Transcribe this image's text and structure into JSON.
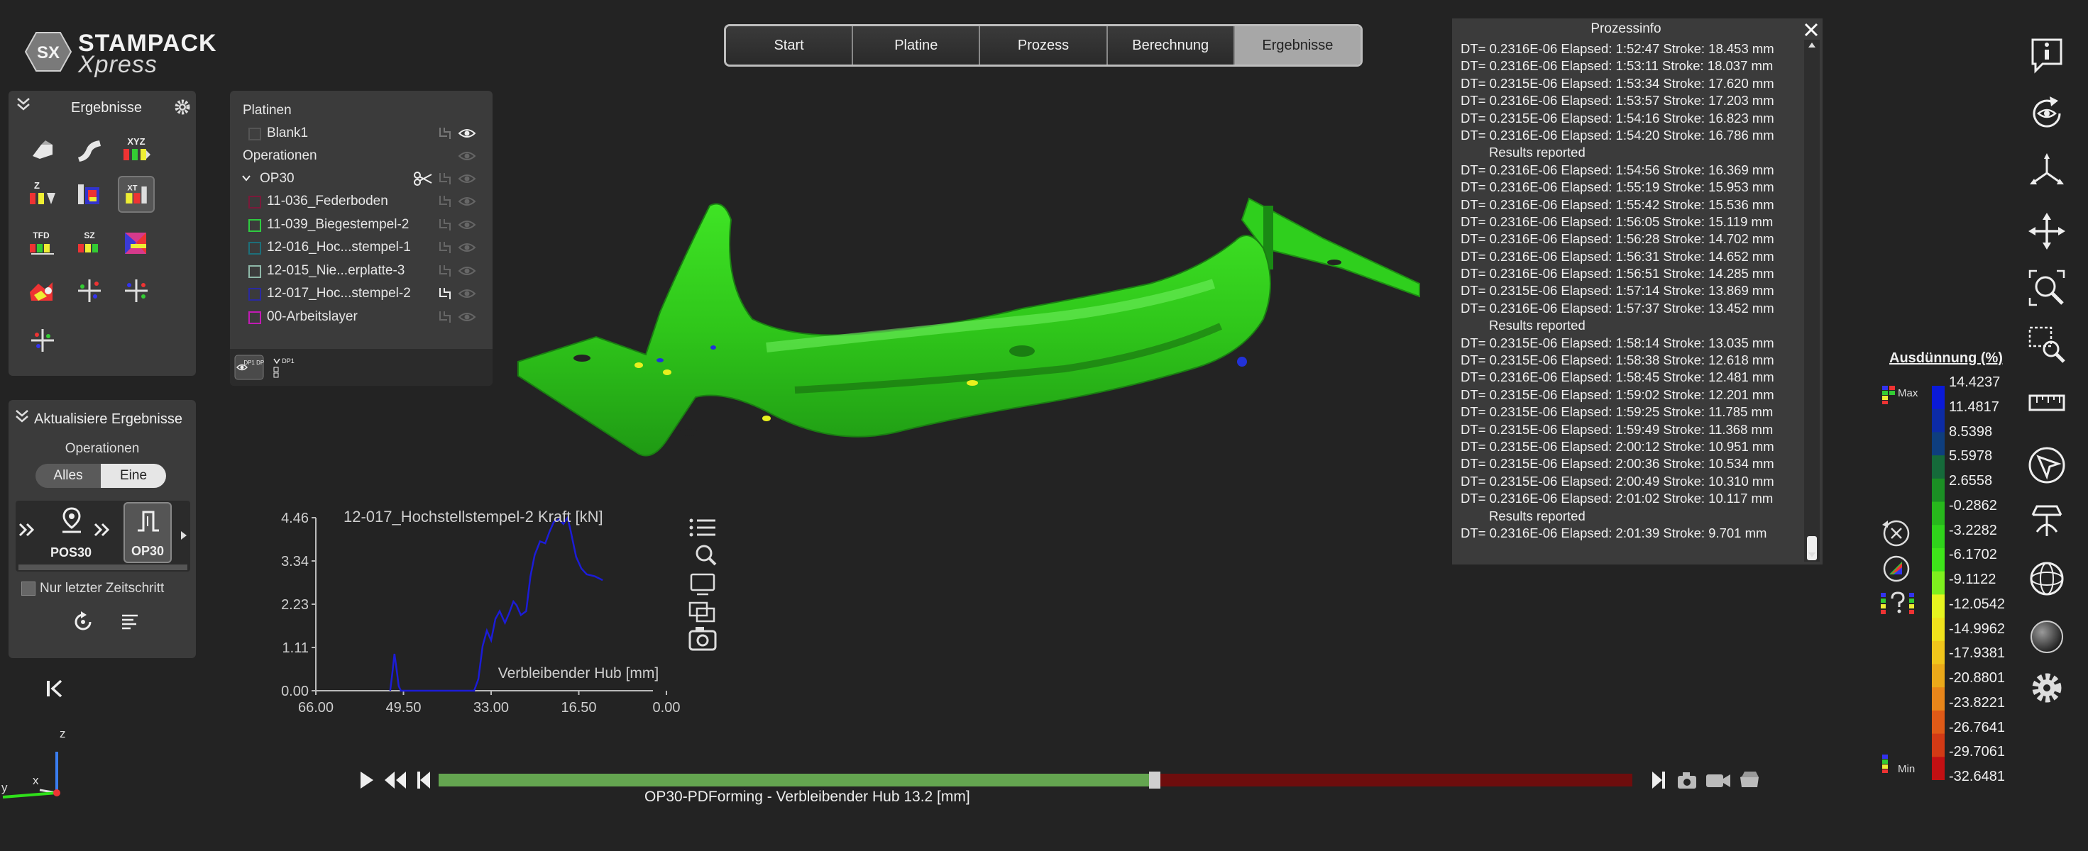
{
  "logo": {
    "badge": "SX",
    "line1": "STAMPACK",
    "line2": "Xpress"
  },
  "tabs": [
    {
      "label": "Start",
      "active": false
    },
    {
      "label": "Platine",
      "active": false
    },
    {
      "label": "Prozess",
      "active": false
    },
    {
      "label": "Berechnung",
      "active": false
    },
    {
      "label": "Ergebnisse",
      "active": true
    }
  ],
  "results_panel": {
    "title": "Ergebnisse",
    "icons": [
      "thinning-icon",
      "shape-icon",
      "xyz-displacement-icon",
      "z-displacement-icon",
      "formability-icon",
      "t-thickness-icon",
      "tfd-icon",
      "sz-icon",
      "strain-icon",
      "wrinkle-icon",
      "springback-icon",
      "vector-icon",
      "trim-icon"
    ],
    "icon_labels": {
      "xyz": "XYZ",
      "z": "Z",
      "xt": "XT",
      "tfd": "TFD",
      "sz": "SZ"
    }
  },
  "update_panel": {
    "title": "Aktualisiere Ergebnisse",
    "sub": "Operationen",
    "seg_all": "Alles",
    "seg_one": "Eine",
    "ops": [
      {
        "label": "POS30"
      },
      {
        "label": "OP30"
      }
    ],
    "checkbox": "Nur letzter Zeitschritt"
  },
  "tree": {
    "section_blanks": "Platinen",
    "blank": "Blank1",
    "section_ops": "Operationen",
    "op": "OP30",
    "tools": [
      {
        "name": "11-036_Federboden",
        "color": "#7a1a3a"
      },
      {
        "name": "11-039_Biegestempel-2",
        "color": "#2ecc40"
      },
      {
        "name": "12-016_Hoc...stempel-1",
        "color": "#1d6f7a"
      },
      {
        "name": "12-015_Nie...erplatte-3",
        "color": "#8fb8a8"
      },
      {
        "name": "12-017_Hoc...stempel-2",
        "color": "#2a2aa0"
      },
      {
        "name": "00-Arbeitslayer",
        "color": "#c21ab4"
      }
    ],
    "foot_a": "DP1 DP2",
    "foot_b": "DP1"
  },
  "chart_data": {
    "type": "line",
    "title": "12-017_Hochstellstempel-2 Kraft [kN]",
    "xlabel": "Verbleibender Hub [mm]",
    "ylabel": "",
    "x_ticks": [
      "66.00",
      "49.50",
      "33.00",
      "16.50",
      "0.00"
    ],
    "y_ticks": [
      "4.46",
      "3.34",
      "2.23",
      "1.11",
      "0.00"
    ],
    "xlim": [
      66.0,
      0.0
    ],
    "ylim": [
      0.0,
      4.46
    ],
    "series": [
      {
        "color": "#1c1cd6",
        "x": [
          52.0,
          51.6,
          51.2,
          50.8,
          50.4,
          50.0,
          49.6,
          49.0,
          45.0,
          40.0,
          36.2,
          35.4,
          34.6,
          33.8,
          33.0,
          32.2,
          31.4,
          30.4,
          29.6,
          28.8,
          28.2,
          27.4,
          26.4,
          25.6,
          24.8,
          23.8,
          22.8,
          22.0,
          21.2,
          20.2,
          19.4,
          18.6,
          18.0,
          17.0,
          16.0,
          15.0,
          13.5,
          12.0
        ],
        "y": [
          0.0,
          0.45,
          0.95,
          0.55,
          0.12,
          0.0,
          0.0,
          0.0,
          0.0,
          0.0,
          0.0,
          0.3,
          1.15,
          1.55,
          1.3,
          1.85,
          2.05,
          1.75,
          2.0,
          2.3,
          2.2,
          1.95,
          2.05,
          2.95,
          3.5,
          3.85,
          3.8,
          4.1,
          4.35,
          4.42,
          4.3,
          4.46,
          4.1,
          3.45,
          3.15,
          3.0,
          2.95,
          2.85
        ]
      }
    ]
  },
  "process_info": {
    "title": "Prozessinfo",
    "lines": [
      "DT= 0.2316E-06  Elapsed: 1:52:47  Stroke: 18.453 mm",
      "DT= 0.2316E-06  Elapsed: 1:53:11  Stroke: 18.037 mm",
      "DT= 0.2315E-06  Elapsed: 1:53:34  Stroke: 17.620 mm",
      "DT= 0.2316E-06  Elapsed: 1:53:57  Stroke: 17.203 mm",
      "DT= 0.2315E-06  Elapsed: 1:54:16  Stroke: 16.823 mm",
      "DT= 0.2316E-06  Elapsed: 1:54:20  Stroke: 16.786 mm",
      "Results reported",
      "DT= 0.2316E-06  Elapsed: 1:54:56  Stroke: 16.369 mm",
      "DT= 0.2316E-06  Elapsed: 1:55:19  Stroke: 15.953 mm",
      "DT= 0.2316E-06  Elapsed: 1:55:42  Stroke: 15.536 mm",
      "DT= 0.2316E-06  Elapsed: 1:56:05  Stroke: 15.119 mm",
      "DT= 0.2316E-06  Elapsed: 1:56:28  Stroke: 14.702 mm",
      "DT= 0.2316E-06  Elapsed: 1:56:31  Stroke: 14.652 mm",
      "DT= 0.2316E-06  Elapsed: 1:56:51  Stroke: 14.285 mm",
      "DT= 0.2315E-06  Elapsed: 1:57:14  Stroke: 13.869 mm",
      "DT= 0.2316E-06  Elapsed: 1:57:37  Stroke: 13.452 mm",
      "Results reported",
      "DT= 0.2315E-06  Elapsed: 1:58:14  Stroke: 13.035 mm",
      "DT= 0.2315E-06  Elapsed: 1:58:38  Stroke: 12.618 mm",
      "DT= 0.2316E-06  Elapsed: 1:58:45  Stroke: 12.481 mm",
      "DT= 0.2315E-06  Elapsed: 1:59:02  Stroke: 12.201 mm",
      "DT= 0.2315E-06  Elapsed: 1:59:25  Stroke: 11.785 mm",
      "DT= 0.2315E-06  Elapsed: 1:59:49  Stroke: 11.368 mm",
      "DT= 0.2315E-06  Elapsed: 2:00:12  Stroke: 10.951 mm",
      "DT= 0.2315E-06  Elapsed: 2:00:36  Stroke: 10.534 mm",
      "DT= 0.2315E-06  Elapsed: 2:00:49  Stroke: 10.310 mm",
      "DT= 0.2316E-06  Elapsed: 2:01:02  Stroke: 10.117 mm",
      "Results reported",
      "DT= 0.2316E-06  Elapsed: 2:01:39  Stroke: 9.701 mm"
    ]
  },
  "legend": {
    "title": "Ausdünnung (%)",
    "max_label": "Max",
    "min_label": "Min",
    "values": [
      "14.4237",
      "11.4817",
      "8.5398",
      "5.5978",
      "2.6558",
      "-0.2862",
      "-3.2282",
      "-6.1702",
      "-9.1122",
      "-12.0542",
      "-14.9962",
      "-17.9381",
      "-20.8801",
      "-23.8221",
      "-26.7641",
      "-29.7061",
      "-32.6481"
    ],
    "colors": [
      "#0a1ad8",
      "#0c2ba6",
      "#0e3e7e",
      "#156a3a",
      "#1b8f24",
      "#27b81c",
      "#2fd31b",
      "#3ee51a",
      "#7ef01e",
      "#e6f41f",
      "#f0e21c",
      "#f0c51b",
      "#eba919",
      "#e8861a",
      "#df5a17",
      "#d23a15",
      "#c21013"
    ]
  },
  "right_toolbar": [
    "info-icon",
    "rotate-view-icon",
    "axes-icon",
    "pan-icon",
    "zoom-icon",
    "zoom-window-icon",
    "ruler-icon",
    "select-pointer-icon",
    "tool-probe-icon",
    "sphere-wire-icon",
    "sphere-solid-icon",
    "settings-gear-icon"
  ],
  "triad": {
    "z": "z",
    "x": "x",
    "y": "y"
  },
  "timeline": {
    "caption": "OP30-PDForming - Verbleibender Hub 13.2 [mm]",
    "progress": 0.6
  }
}
